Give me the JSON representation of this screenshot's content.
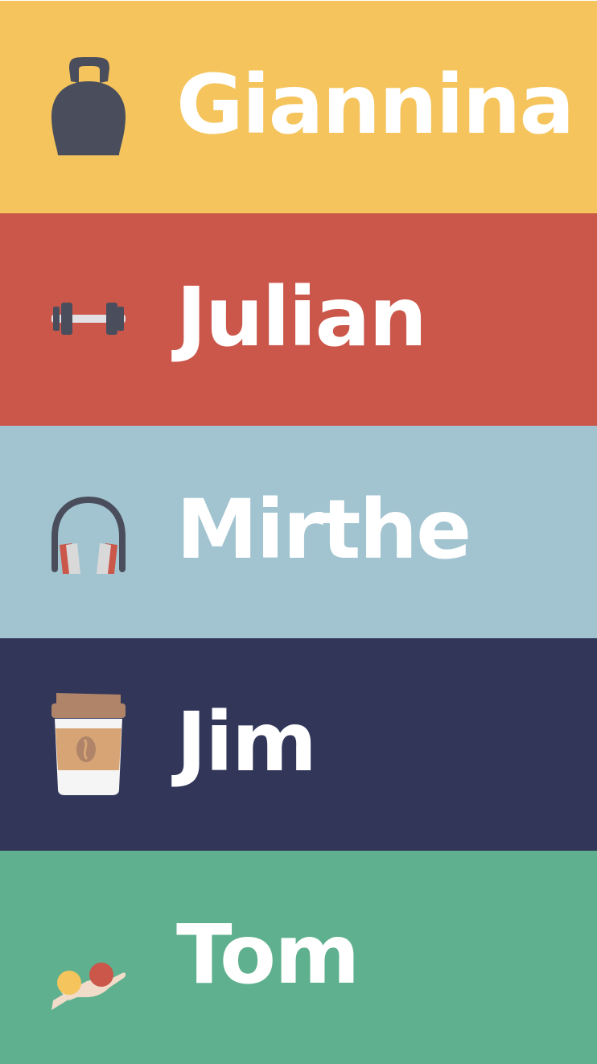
{
  "people": [
    {
      "name": "Giannina",
      "icon": "kettlebell-icon",
      "color": "#F5C45C"
    },
    {
      "name": "Julian",
      "icon": "dumbbell-icon",
      "color": "#CB574B"
    },
    {
      "name": "Mirthe",
      "icon": "headphones-icon",
      "color": "#A2C4D0"
    },
    {
      "name": "Jim",
      "icon": "coffee-cup-icon",
      "color": "#32375A"
    },
    {
      "name": "Tom",
      "icon": "hand-with-balls-icon",
      "color": "#5FB08E"
    }
  ]
}
